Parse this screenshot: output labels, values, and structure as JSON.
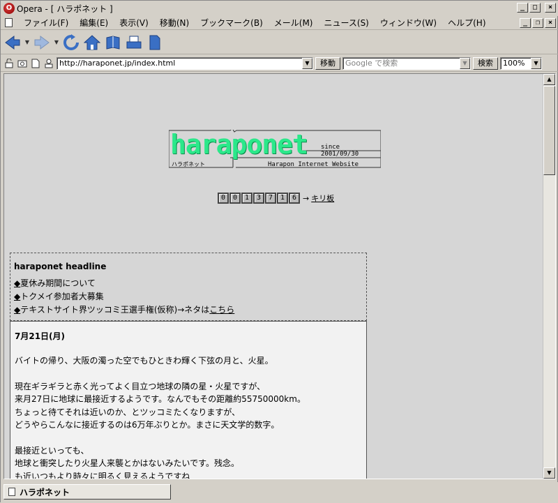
{
  "window": {
    "title": "Opera - [ ハラポネット ]",
    "app_icon_letter": "O"
  },
  "menu": {
    "items": [
      "ファイル(F)",
      "編集(E)",
      "表示(V)",
      "移動(N)",
      "ブックマーク(B)",
      "メール(M)",
      "ニュース(S)",
      "ウィンドウ(W)",
      "ヘルプ(H)"
    ]
  },
  "address": {
    "url": "http://haraponet.jp/index.html",
    "go_label": "移動",
    "search_placeholder": "Google で検索",
    "search_label": "検索",
    "zoom": "100%"
  },
  "page": {
    "logo": {
      "word": "haraponet",
      "since": "since 2001/09/30",
      "kana": "ハラポネット",
      "subtitle": "Harapon Internet Website"
    },
    "counter": {
      "digits": [
        "0",
        "0",
        "1",
        "3",
        "7",
        "1",
        "6"
      ],
      "arrow": "→",
      "kiriban_label": "キリ板"
    },
    "headline": {
      "title": "haraponet headline",
      "items": [
        {
          "bullet": "◆",
          "text": "夏休み期間について",
          "link": ""
        },
        {
          "bullet": "◆",
          "text": "トクメイ参加者大募集",
          "link": ""
        },
        {
          "bullet": "◆",
          "text": "テキストサイト界ツッコミ王選手権(仮称)→ネタは",
          "link": "こちら"
        }
      ]
    },
    "diary": {
      "date": "7月21日(月)",
      "lines": [
        "バイトの帰り、大阪の濁った空でもひときわ輝く下弦の月と、火星。",
        "",
        "現在ギラギラと赤く光ってよく目立つ地球の隣の星・火星ですが、",
        "来月27日に地球に最接近するようです。なんでもその距離約55750000km。",
        "ちょっと待てそれは近いのか、とツッコミたくなりますが、",
        "どうやらこんなに接近するのは6万年ぶりとか。まさに天文学的数字。",
        "",
        "最接近といっても、",
        "地球と衝突したり火星人来襲とかはないみたいです。残念。",
        "も近いつもより時々に明るく見えるようですね"
      ]
    }
  },
  "status": {
    "tab_label": "ハラポネット"
  }
}
